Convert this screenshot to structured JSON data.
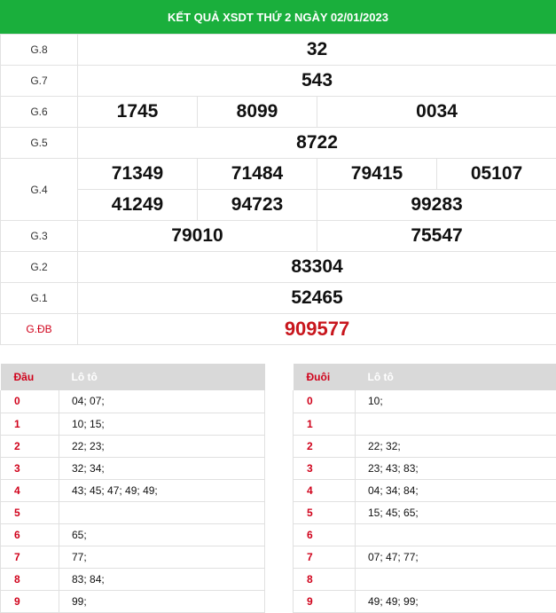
{
  "title": "KẾT QUẢ XSDT THỨ 2 NGÀY 02/01/2023",
  "prizes": {
    "g8": {
      "label": "G.8",
      "values": [
        "32"
      ]
    },
    "g7": {
      "label": "G.7",
      "values": [
        "543"
      ]
    },
    "g6": {
      "label": "G.6",
      "values": [
        "1745",
        "8099",
        "0034"
      ]
    },
    "g5": {
      "label": "G.5",
      "values": [
        "8722"
      ]
    },
    "g4": {
      "label": "G.4",
      "values": [
        "71349",
        "71484",
        "79415",
        "05107",
        "41249",
        "94723",
        "99283"
      ]
    },
    "g3": {
      "label": "G.3",
      "values": [
        "79010",
        "75547"
      ]
    },
    "g2": {
      "label": "G.2",
      "values": [
        "83304"
      ]
    },
    "g1": {
      "label": "G.1",
      "values": [
        "52465"
      ]
    },
    "gdb": {
      "label": "G.ĐB",
      "values": [
        "909577"
      ]
    }
  },
  "dau_table": {
    "header_key": "Đầu",
    "header_val": "Lô tô",
    "rows": [
      {
        "k": "0",
        "v": "04; 07;"
      },
      {
        "k": "1",
        "v": "10; 15;"
      },
      {
        "k": "2",
        "v": "22; 23;"
      },
      {
        "k": "3",
        "v": "32; 34;"
      },
      {
        "k": "4",
        "v": "43; 45; 47; 49; 49;"
      },
      {
        "k": "5",
        "v": ""
      },
      {
        "k": "6",
        "v": "65;"
      },
      {
        "k": "7",
        "v": "77;"
      },
      {
        "k": "8",
        "v": "83; 84;"
      },
      {
        "k": "9",
        "v": "99;"
      }
    ]
  },
  "duoi_table": {
    "header_key": "Đuôi",
    "header_val": "Lô tô",
    "rows": [
      {
        "k": "0",
        "v": "10;"
      },
      {
        "k": "1",
        "v": ""
      },
      {
        "k": "2",
        "v": "22; 32;"
      },
      {
        "k": "3",
        "v": "23; 43; 83;"
      },
      {
        "k": "4",
        "v": "04; 34; 84;"
      },
      {
        "k": "5",
        "v": "15; 45; 65;"
      },
      {
        "k": "6",
        "v": ""
      },
      {
        "k": "7",
        "v": "07; 47; 77;"
      },
      {
        "k": "8",
        "v": ""
      },
      {
        "k": "9",
        "v": "49; 49; 99;"
      }
    ]
  }
}
